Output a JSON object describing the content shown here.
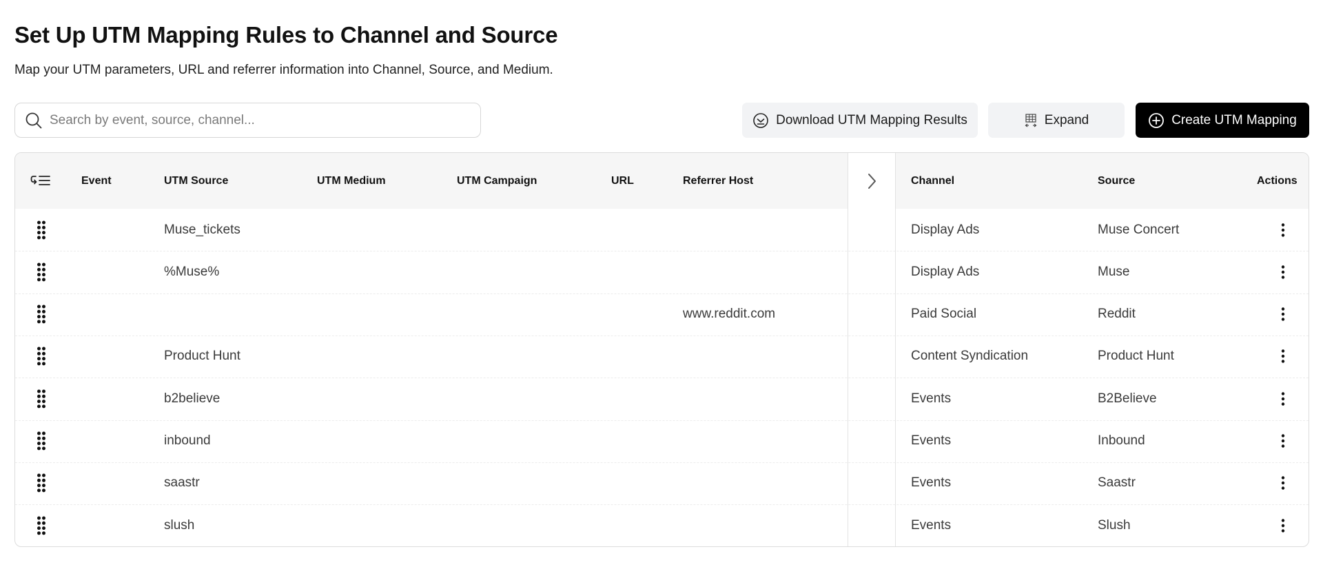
{
  "page": {
    "title": "Set Up UTM Mapping Rules to Channel and Source",
    "subtitle": "Map your UTM parameters, URL and referrer information into Channel, Source, and Medium."
  },
  "search": {
    "placeholder": "Search by event, source, channel...",
    "value": "",
    "icon": "search-icon"
  },
  "toolbar": {
    "download_label": "Download UTM Mapping Results",
    "download_icon": "download-circle-icon",
    "expand_label": "Expand",
    "expand_icon": "expand-columns-icon",
    "create_label": "Create UTM Mapping",
    "create_icon": "plus-circle-icon"
  },
  "table": {
    "columns": {
      "event": "Event",
      "utm_source": "UTM Source",
      "utm_medium": "UTM Medium",
      "utm_campaign": "UTM Campaign",
      "url": "URL",
      "referrer_host": "Referrer Host",
      "channel": "Channel",
      "source": "Source",
      "actions": "Actions"
    },
    "rows": [
      {
        "event": "",
        "utm_source": "Muse_tickets",
        "utm_medium": "",
        "utm_campaign": "",
        "url": "",
        "referrer_host": "",
        "channel": "Display Ads",
        "source": "Muse Concert"
      },
      {
        "event": "",
        "utm_source": "%Muse%",
        "utm_medium": "",
        "utm_campaign": "",
        "url": "",
        "referrer_host": "",
        "channel": "Display Ads",
        "source": "Muse"
      },
      {
        "event": "",
        "utm_source": "",
        "utm_medium": "",
        "utm_campaign": "",
        "url": "",
        "referrer_host": "www.reddit.com",
        "channel": "Paid Social",
        "source": "Reddit"
      },
      {
        "event": "",
        "utm_source": "Product Hunt",
        "utm_medium": "",
        "utm_campaign": "",
        "url": "",
        "referrer_host": "",
        "channel": "Content Syndication",
        "source": "Product Hunt"
      },
      {
        "event": "",
        "utm_source": "b2believe",
        "utm_medium": "",
        "utm_campaign": "",
        "url": "",
        "referrer_host": "",
        "channel": "Events",
        "source": "B2Believe"
      },
      {
        "event": "",
        "utm_source": "inbound",
        "utm_medium": "",
        "utm_campaign": "",
        "url": "",
        "referrer_host": "",
        "channel": "Events",
        "source": "Inbound"
      },
      {
        "event": "",
        "utm_source": "saastr",
        "utm_medium": "",
        "utm_campaign": "",
        "url": "",
        "referrer_host": "",
        "channel": "Events",
        "source": "Saastr"
      },
      {
        "event": "",
        "utm_source": "slush",
        "utm_medium": "",
        "utm_campaign": "",
        "url": "",
        "referrer_host": "",
        "channel": "Events",
        "source": "Slush"
      }
    ]
  },
  "colors": {
    "primary_button": "#000000",
    "secondary_button": "#f2f3f5",
    "header_bg": "#f6f6f6",
    "border": "#dcdcdc"
  }
}
